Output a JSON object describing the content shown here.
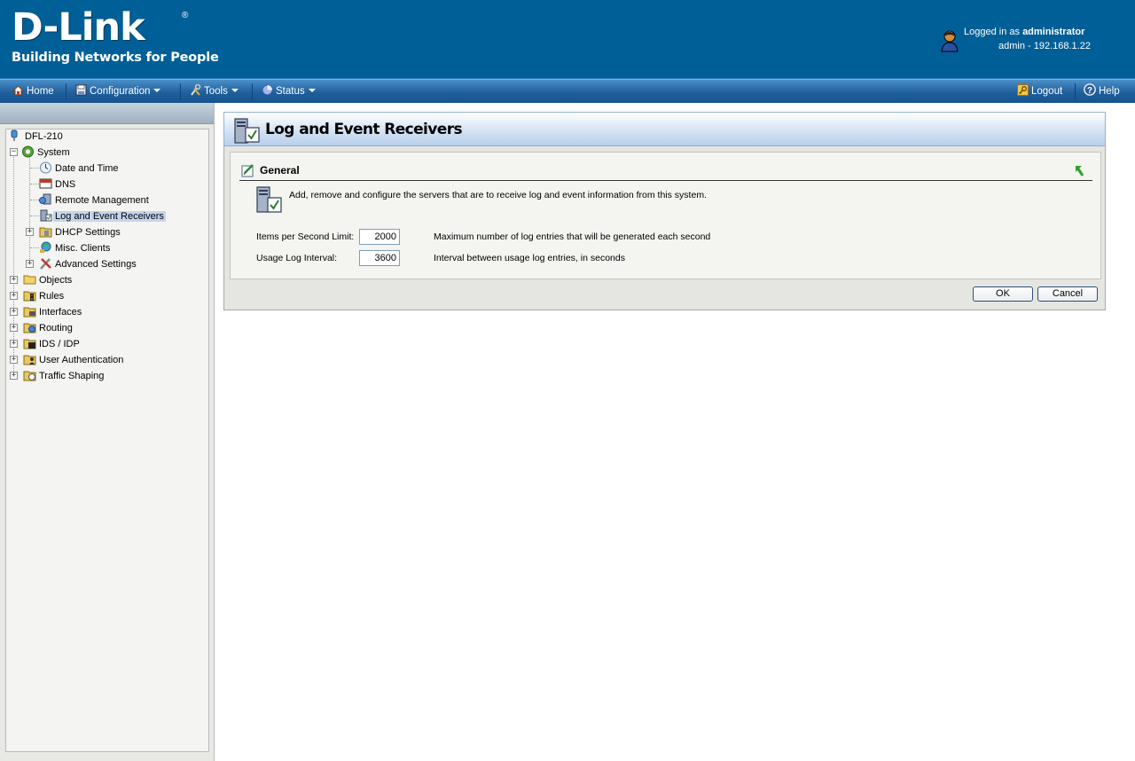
{
  "header": {
    "brand": "D-Link",
    "registered": "®",
    "tagline": "Building Networks for People",
    "login_prefix": "Logged in as",
    "login_user": "administrator",
    "session": "admin - 192.168.1.22"
  },
  "menu": {
    "home": "Home",
    "configuration": "Configuration",
    "tools": "Tools",
    "status": "Status",
    "logout": "Logout",
    "help": "Help"
  },
  "tree": {
    "root": "DFL-210",
    "system": "System",
    "date_time": "Date and Time",
    "dns": "DNS",
    "remote_management": "Remote Management",
    "log_receivers": "Log and Event Receivers",
    "dhcp_settings": "DHCP Settings",
    "misc_clients": "Misc. Clients",
    "advanced_settings": "Advanced Settings",
    "objects": "Objects",
    "rules": "Rules",
    "interfaces": "Interfaces",
    "routing": "Routing",
    "ids_idp": "IDS / IDP",
    "user_auth": "User Authentication",
    "traffic_shaping": "Traffic Shaping"
  },
  "page": {
    "title": "Log and Event Receivers",
    "section_title": "General",
    "description": "Add, remove and configure the servers that are to receive log and event information from this system."
  },
  "form": {
    "items_per_second": {
      "label": "Items per Second Limit:",
      "value": "2000",
      "help": "Maximum number of log entries that will be generated each second"
    },
    "usage_log_interval": {
      "label": "Usage Log Interval:",
      "value": "3600",
      "help": "Interval between usage log entries, in seconds"
    }
  },
  "buttons": {
    "ok": "OK",
    "cancel": "Cancel"
  },
  "colors": {
    "header_bg": "#005f96",
    "menubar": "#1e5f9c",
    "selection": "#c5d5ec"
  }
}
